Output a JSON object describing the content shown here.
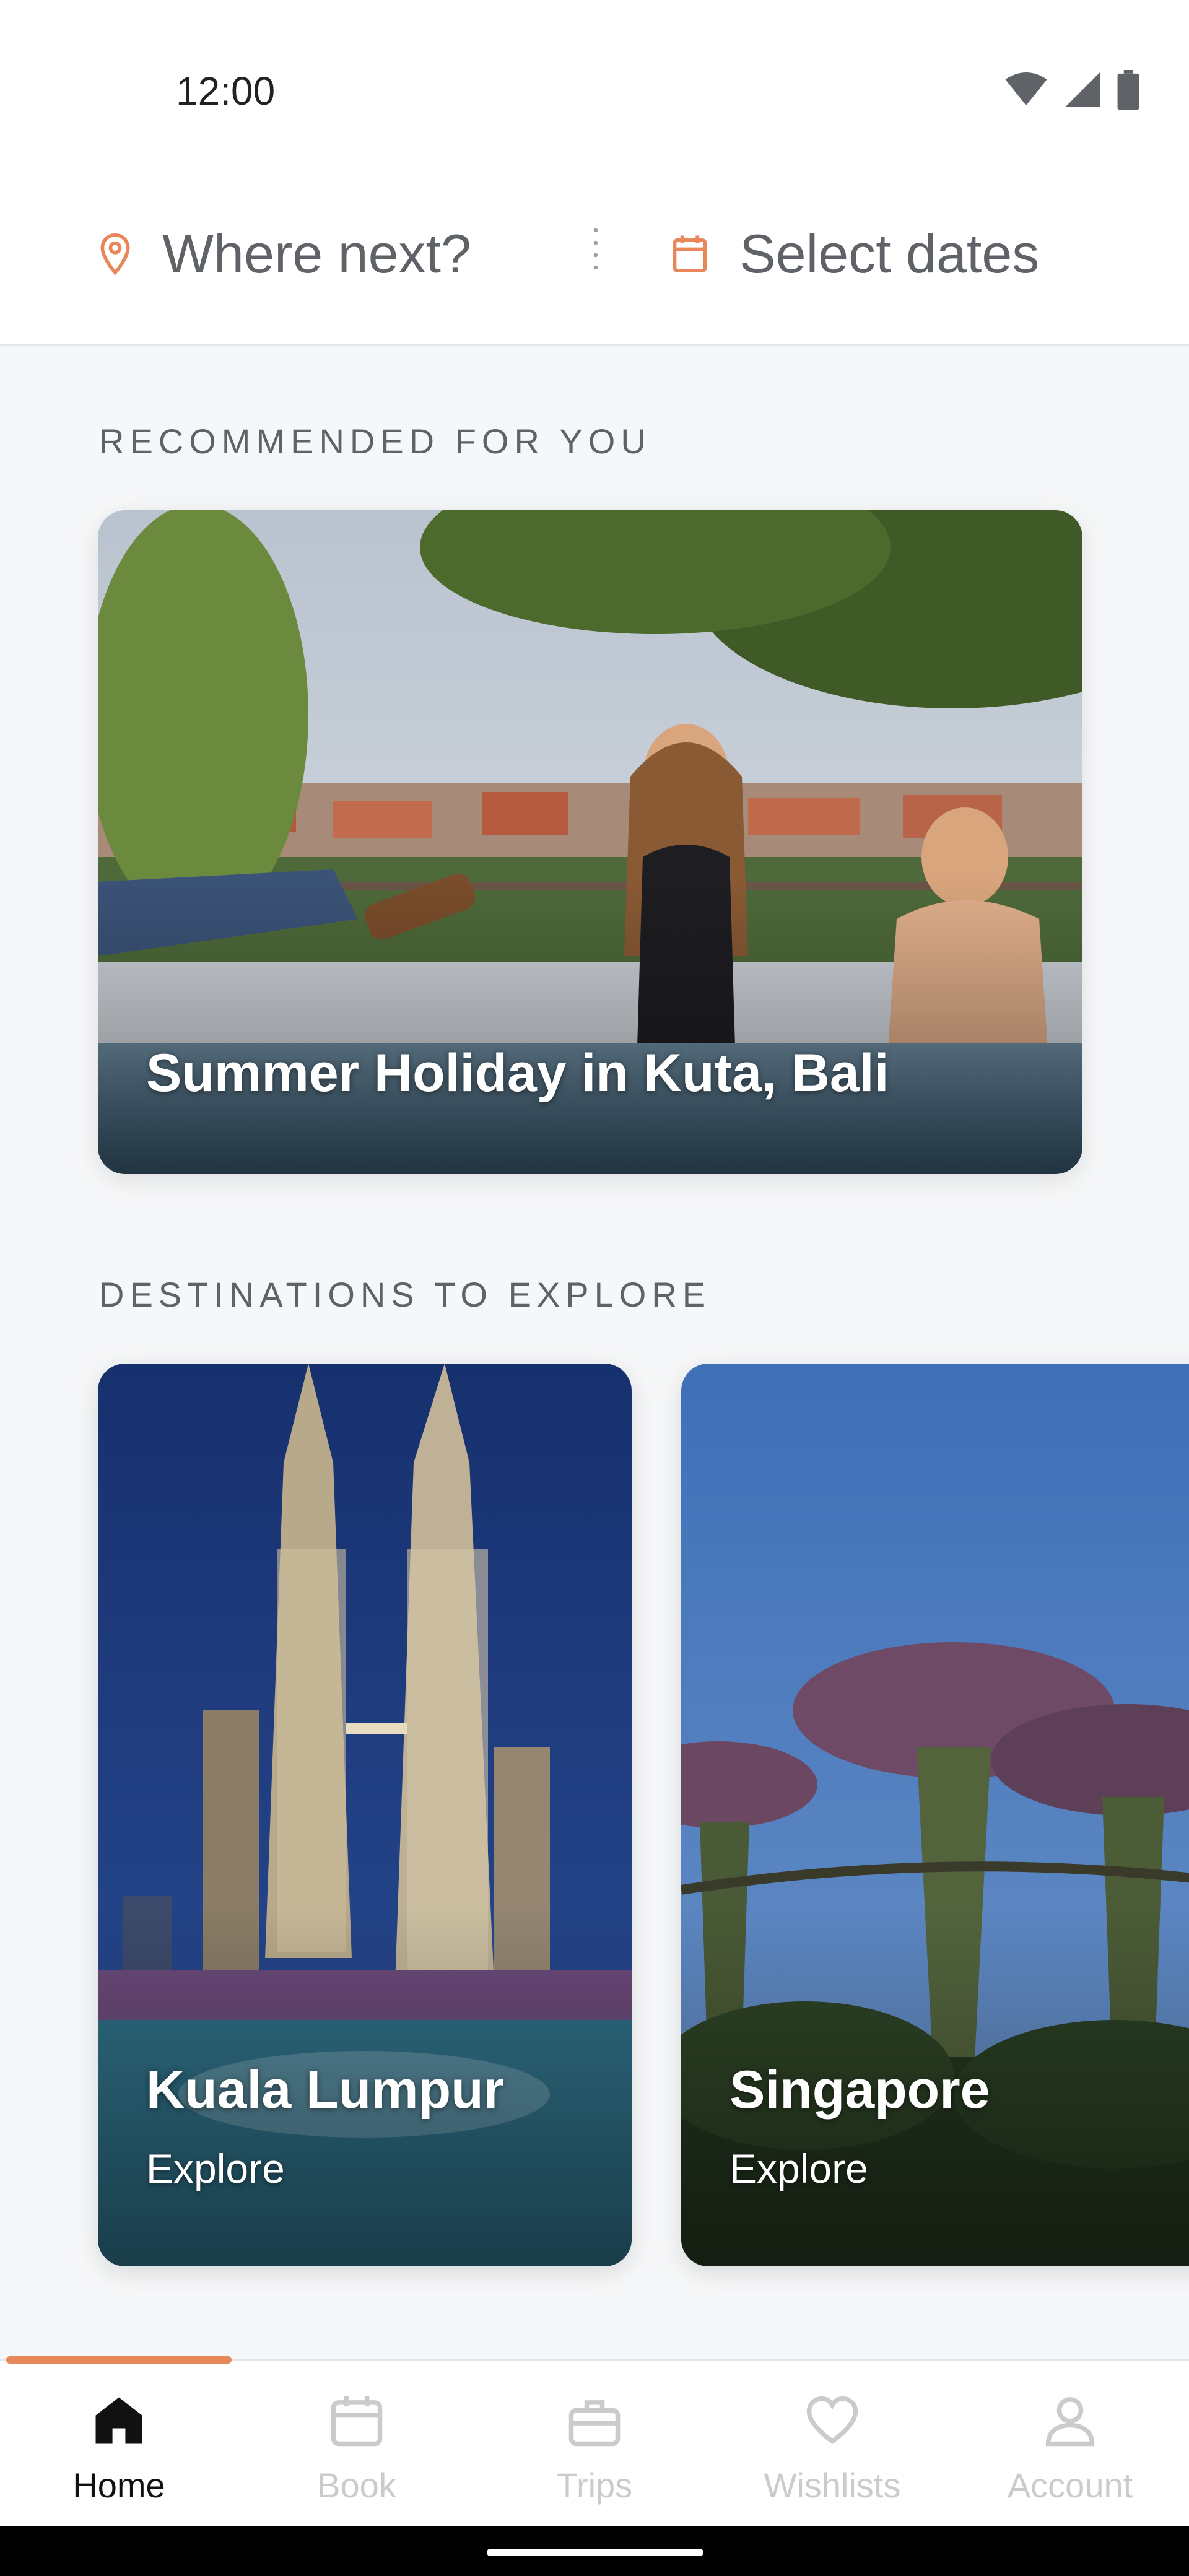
{
  "status_bar": {
    "time": "12:00",
    "icons": [
      "wifi-icon",
      "signal-icon",
      "battery-icon"
    ]
  },
  "search": {
    "where_placeholder": "Where next?",
    "dates_placeholder": "Select dates",
    "location_icon": "location-pin-icon",
    "calendar_icon": "calendar-icon",
    "accent_color": "#e8875a"
  },
  "recommended": {
    "section_title": "RECOMMENDED FOR YOU",
    "card": {
      "title": "Summer Holiday in Kuta, Bali"
    }
  },
  "destinations": {
    "section_title": "DESTINATIONS TO EXPLORE",
    "cards": [
      {
        "name": "Kuala Lumpur",
        "action": "Explore"
      },
      {
        "name": "Singapore",
        "action": "Explore"
      }
    ]
  },
  "bottom_nav": {
    "active_color": "#111111",
    "inactive_color": "#c9cbcd",
    "indicator_color": "#e8875a",
    "items": [
      {
        "label": "Home",
        "icon": "home-icon",
        "active": true
      },
      {
        "label": "Book",
        "icon": "calendar-icon",
        "active": false
      },
      {
        "label": "Trips",
        "icon": "briefcase-icon",
        "active": false
      },
      {
        "label": "Wishlists",
        "icon": "heart-icon",
        "active": false
      },
      {
        "label": "Account",
        "icon": "person-icon",
        "active": false
      }
    ]
  }
}
